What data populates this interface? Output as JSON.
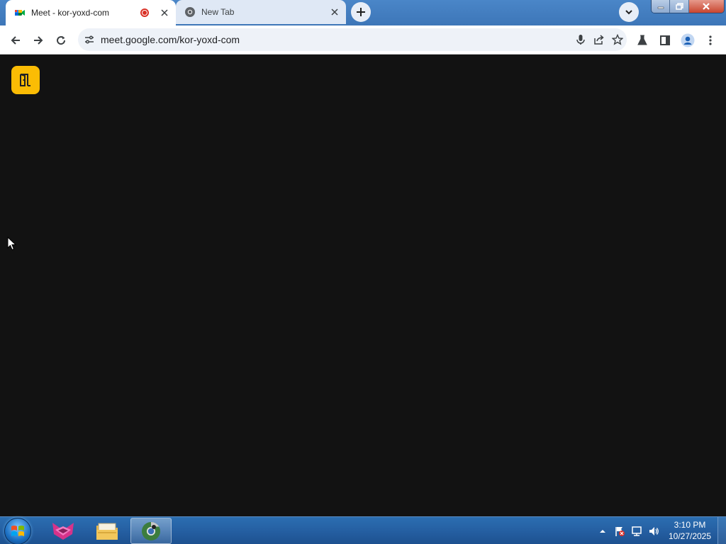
{
  "browser": {
    "tabs": [
      {
        "title": "Meet - kor-yoxd-com",
        "active": true,
        "recording": true,
        "icon": "google-meet-icon"
      },
      {
        "title": "New Tab",
        "active": false,
        "icon": "chrome-icon"
      }
    ],
    "address_bar": {
      "url": "meet.google.com/kor-yoxd-com"
    }
  },
  "page": {
    "background_color": "#121212",
    "leave_button_color": "#fbbc04",
    "leave_button_icon": "door-exit-icon"
  },
  "taskbar": {
    "apps": [
      "browser-extension-app-icon",
      "file-explorer-icon",
      "chrome-icon"
    ],
    "clock": {
      "time": "3:10 PM",
      "date": "10/27/2025"
    }
  },
  "colors": {
    "titlebar": "#3d76b8",
    "recording_red": "#d93025",
    "taskbar": "#2661a4"
  }
}
